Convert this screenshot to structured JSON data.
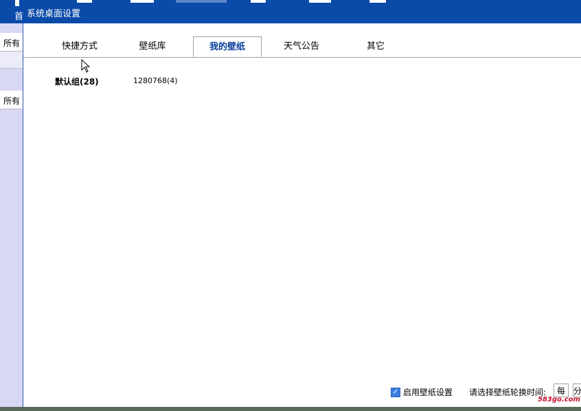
{
  "topbar": {
    "home_label": "首",
    "dialog_title": "系统桌面设置"
  },
  "left_panel": {
    "items": [
      "所有",
      "",
      "所有"
    ]
  },
  "tabs": [
    {
      "label": "快捷方式",
      "active": false
    },
    {
      "label": "壁纸库",
      "active": false
    },
    {
      "label": "我的壁纸",
      "active": true
    },
    {
      "label": "天气公告",
      "active": false
    },
    {
      "label": "其它",
      "active": false
    }
  ],
  "content": {
    "group_name": "默认组(28)",
    "group_item": "1280768(4)"
  },
  "footer": {
    "enable_label": "启用壁纸设置",
    "enable_checked": true,
    "rotation_label": "请选择壁纸轮换时间:",
    "select_value": "每",
    "select_unit": "分"
  },
  "watermark": "583go.com",
  "colors": {
    "titlebar": "#0a4aa8",
    "active_tab_text": "#0a3f9a",
    "checkbox": "#3c7ee0"
  }
}
